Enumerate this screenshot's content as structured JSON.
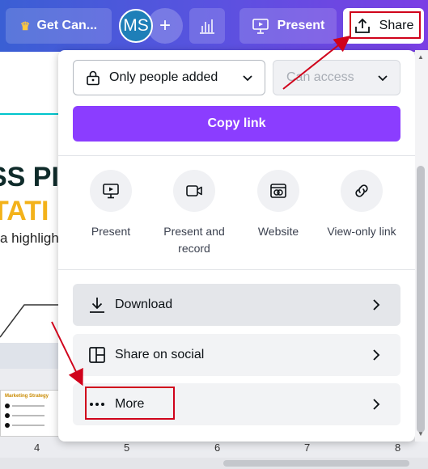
{
  "topbar": {
    "get_canva_label": "Get Can...",
    "avatar_initials": "MS",
    "add_label": "+",
    "present_label": "Present",
    "share_label": "Share"
  },
  "slide": {
    "heading_line1": "SS PI",
    "heading_line2": "TATI",
    "subtitle": "a highligh",
    "thumb_title": "Marketing Strategy"
  },
  "pages": [
    "4",
    "5",
    "6",
    "7",
    "8"
  ],
  "share_panel": {
    "access_value": "Only people added",
    "permission_placeholder": "Can access",
    "copy_link_label": "Copy link",
    "options": [
      {
        "label": "Present",
        "icon": "present-icon"
      },
      {
        "label": "Present and record",
        "icon": "record-icon"
      },
      {
        "label": "Website",
        "icon": "website-icon"
      },
      {
        "label": "View-only link",
        "icon": "link-icon"
      }
    ],
    "rows": [
      {
        "label": "Download",
        "icon": "download-icon"
      },
      {
        "label": "Share on social",
        "icon": "social-icon"
      },
      {
        "label": "More",
        "icon": "more-icon"
      }
    ]
  },
  "colors": {
    "accent_purple": "#8b3dff",
    "annotation_red": "#d0021b",
    "topbar_gradient_start": "#3a5fd4",
    "topbar_gradient_end": "#7b3fe4"
  }
}
